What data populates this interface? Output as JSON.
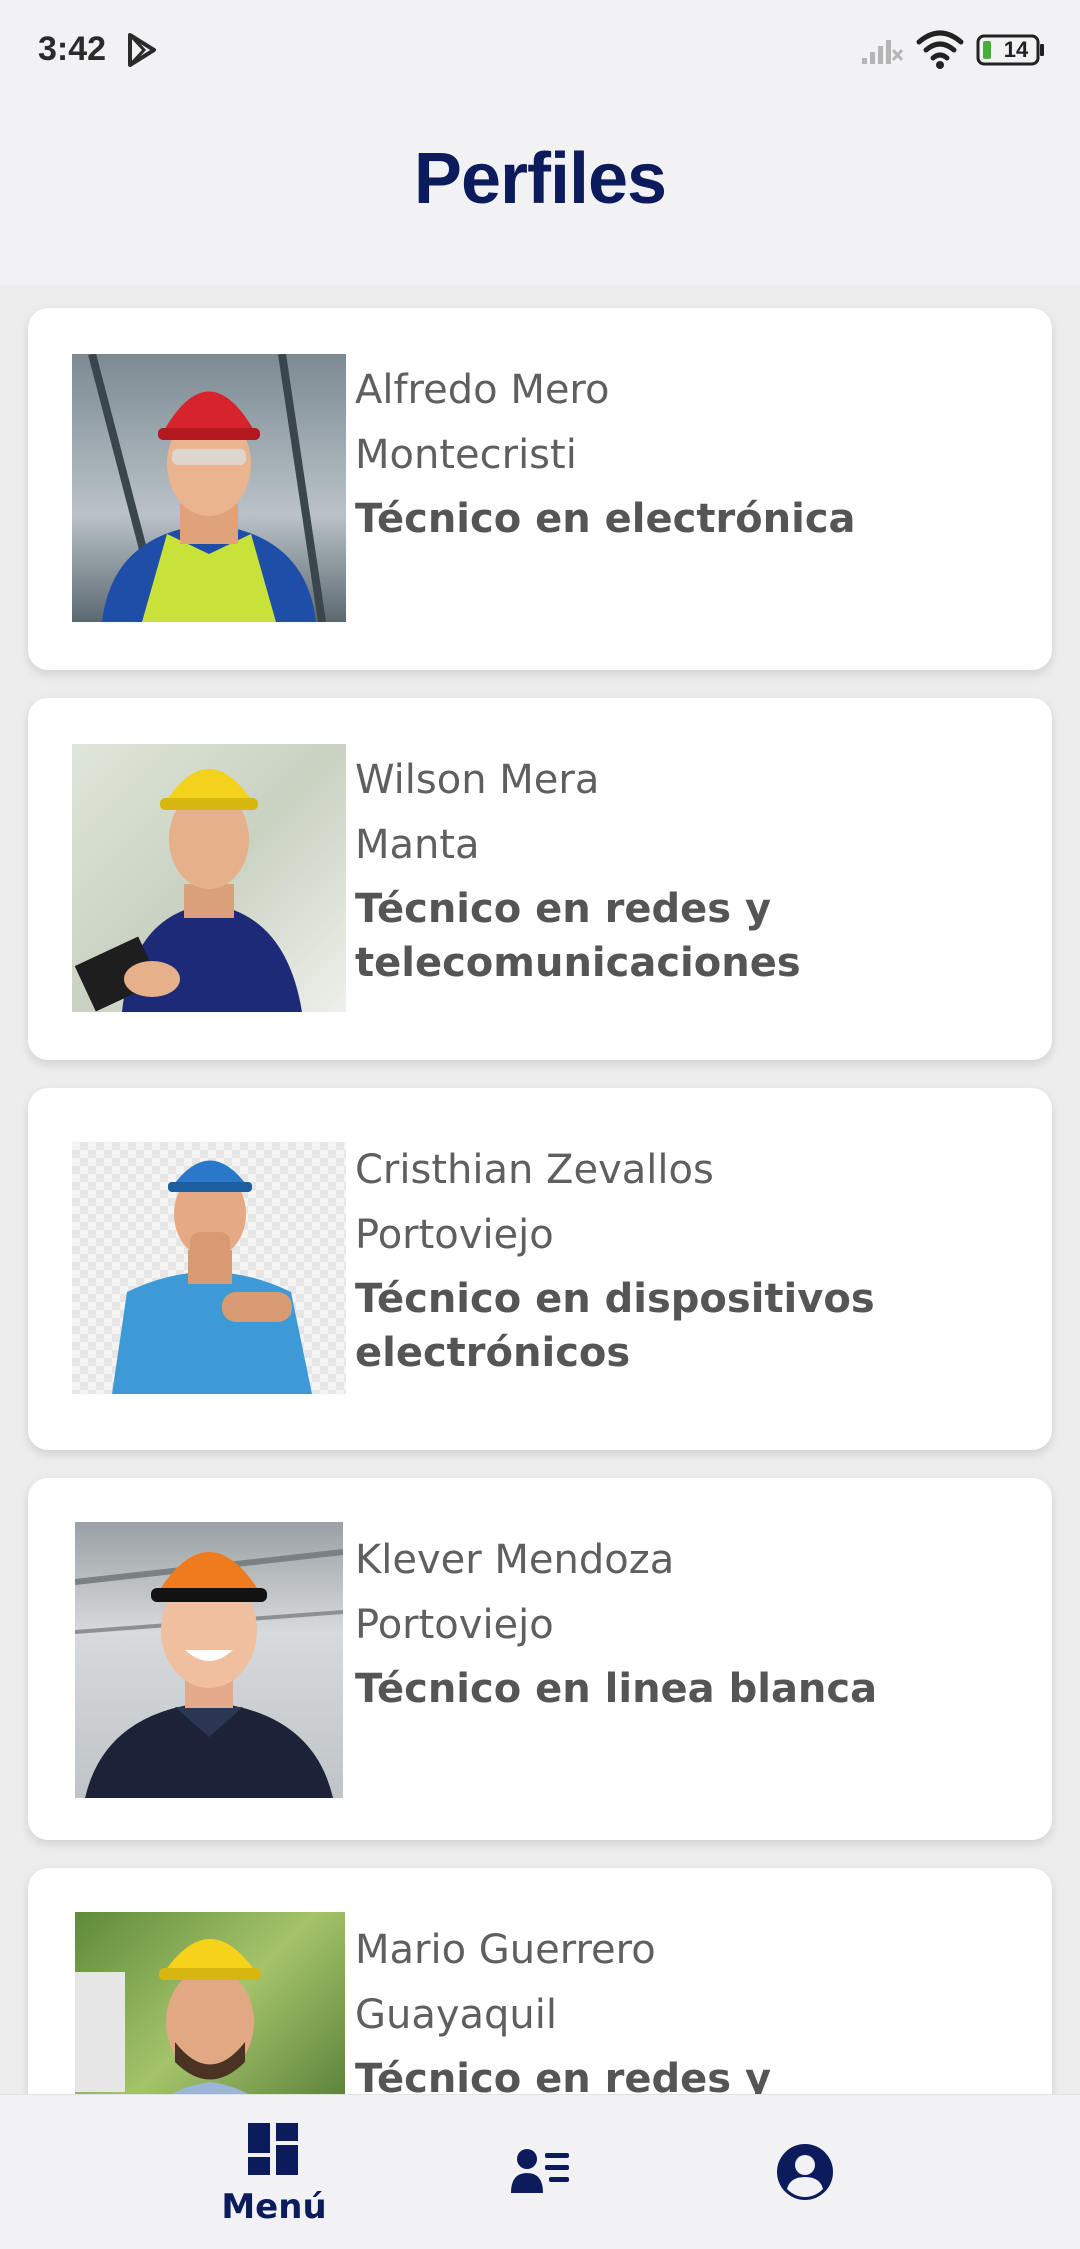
{
  "status_bar": {
    "time": "3:42",
    "battery": "14",
    "icons": [
      "play-store-icon",
      "signal-icon",
      "wifi-icon",
      "battery-icon"
    ]
  },
  "header": {
    "title": "Perfiles"
  },
  "profiles": [
    {
      "name": "Alfredo Mero",
      "city": "Montecristi",
      "specialty": "Técnico en electrónica",
      "helmet_color": "#d7232c",
      "shirt_color": "#1f4ea8"
    },
    {
      "name": "Wilson Mera",
      "city": "Manta",
      "specialty": "Técnico en redes y telecomunicaciones",
      "helmet_color": "#f2d21c",
      "shirt_color": "#1d2a78"
    },
    {
      "name": "Cristhian Zevallos",
      "city": "Portoviejo",
      "specialty": "Técnico en dispositivos electrónicos",
      "helmet_color": "#2a78c9",
      "shirt_color": "#3d9ad6"
    },
    {
      "name": "Klever Mendoza",
      "city": "Portoviejo",
      "specialty": "Técnico en linea blanca",
      "helmet_color": "#f07a1e",
      "shirt_color": "#1c2238"
    },
    {
      "name": "Mario Guerrero",
      "city": "Guayaquil",
      "specialty": "Técnico en redes y",
      "helmet_color": "#f6d21a",
      "shirt_color": "#9db5d6"
    }
  ],
  "bottom_nav": {
    "items": [
      {
        "icon": "dashboard-icon",
        "label": "Menú"
      },
      {
        "icon": "contacts-list-icon",
        "label": ""
      },
      {
        "icon": "account-circle-icon",
        "label": ""
      }
    ]
  },
  "colors": {
    "brand": "#0c1b5c",
    "text_gray": "#5f5f5f",
    "card_bg": "#ffffff",
    "page_bg": "#ededed"
  }
}
